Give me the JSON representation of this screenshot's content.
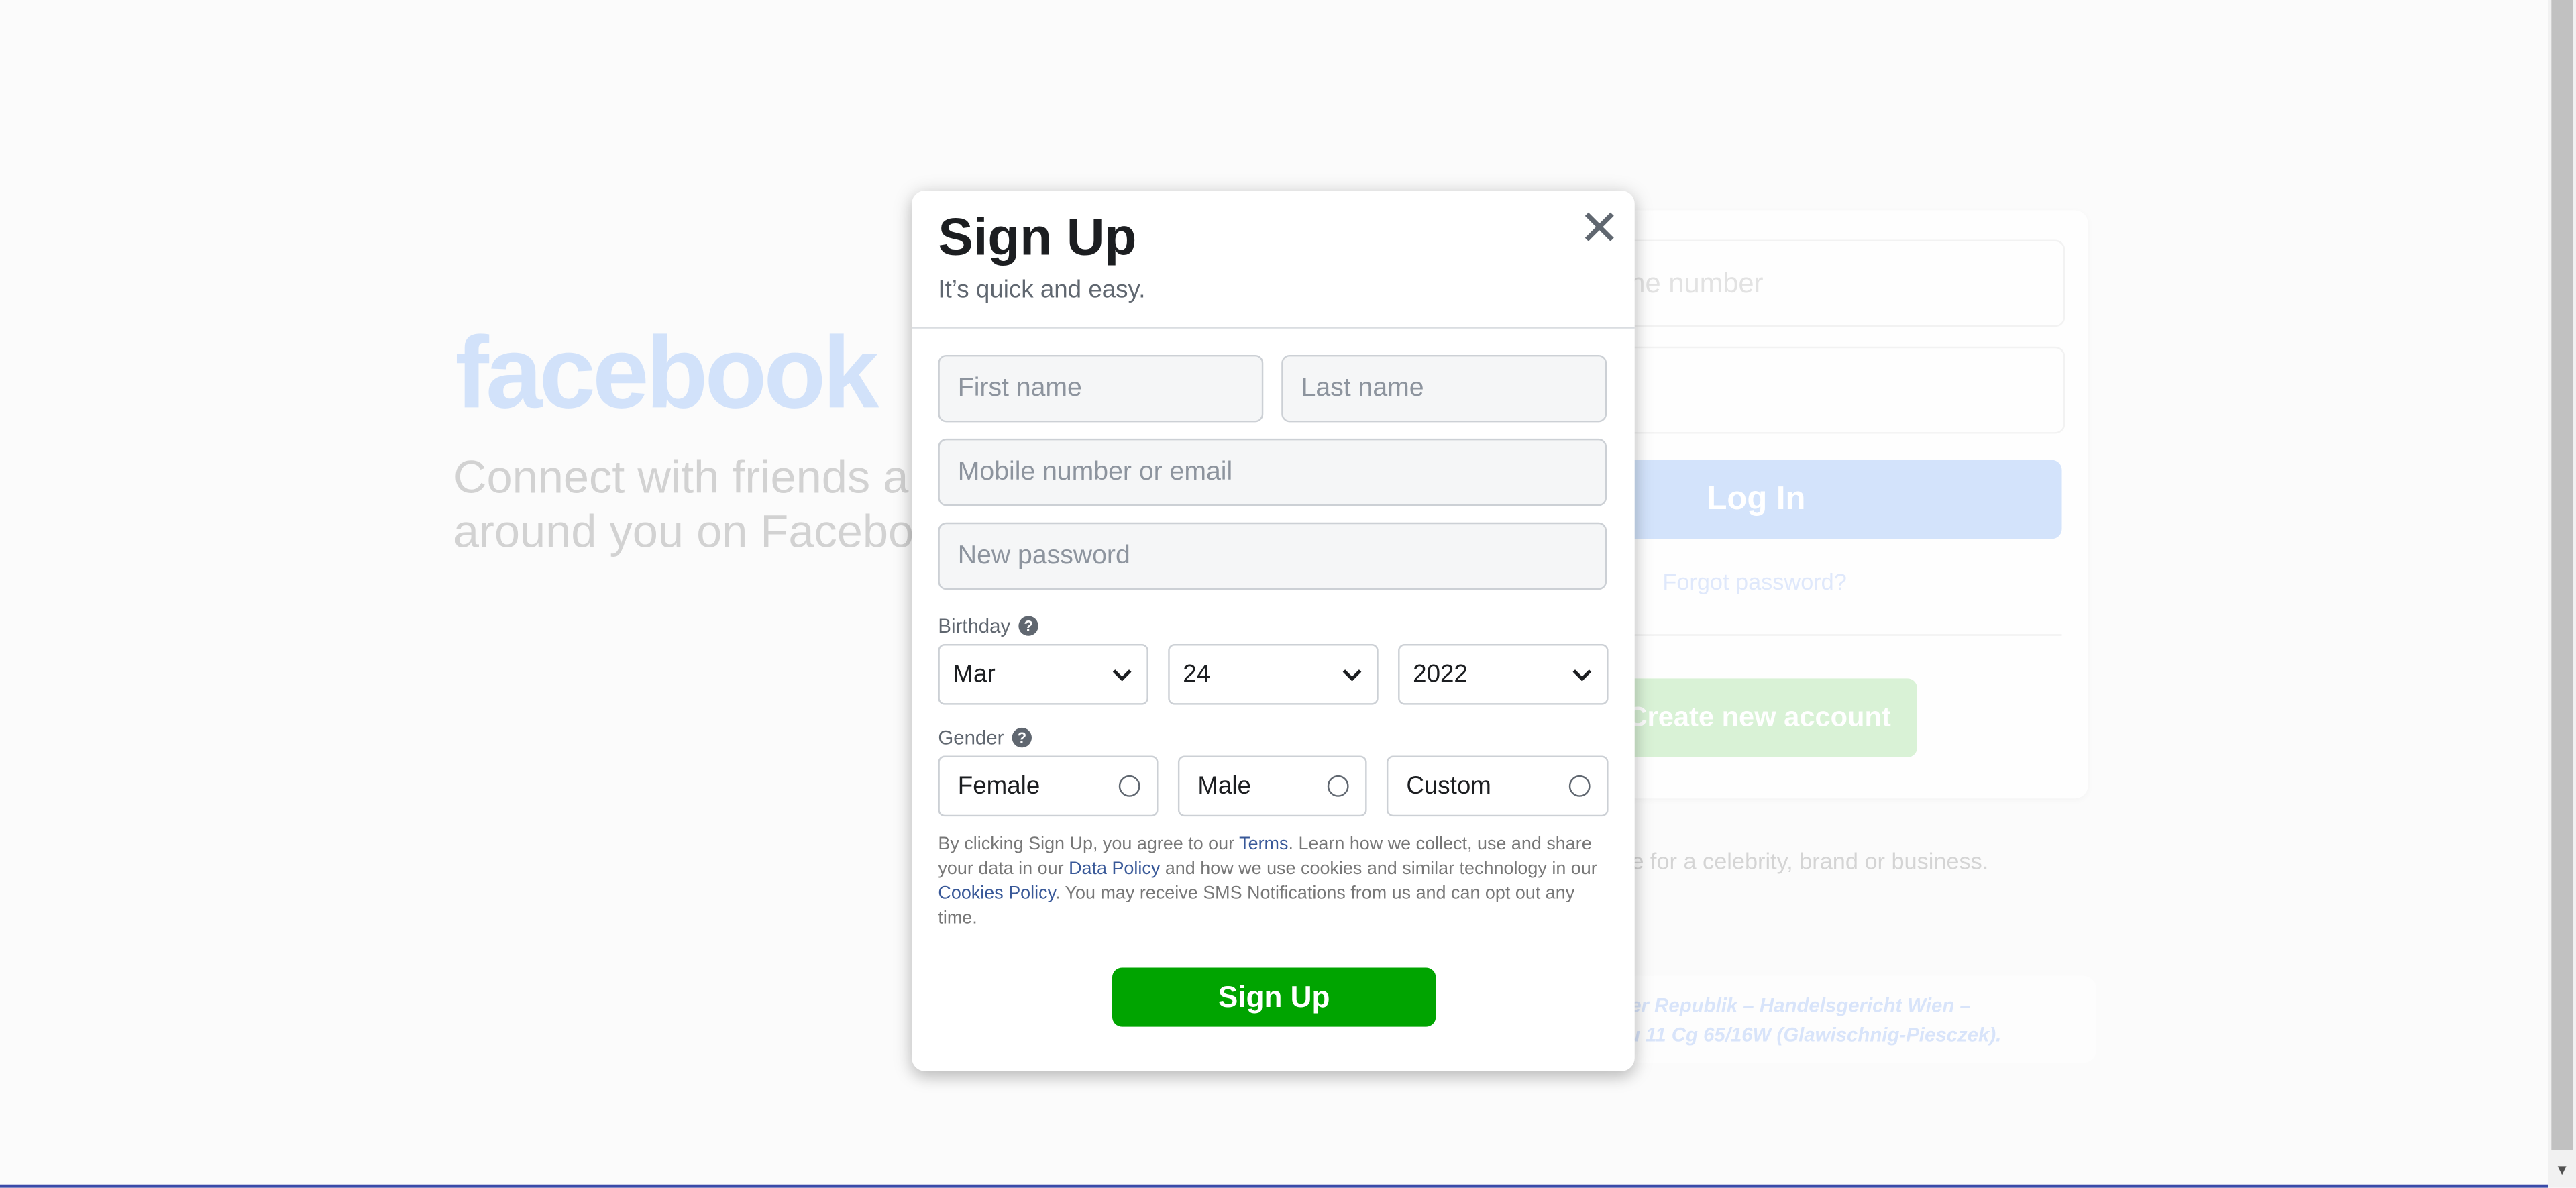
{
  "background": {
    "logo": "facebook",
    "tagline_lines": [
      "Connect with friends a",
      "around you on Facebo"
    ],
    "login": {
      "email_placeholder_fragment": "ne number",
      "login_label": "Log In",
      "forgot_label": "Forgot password?",
      "create_label": "Create new account"
    },
    "page_line_fragment": "ge for a celebrity, brand or business.",
    "footer_lines": [
      "der Republik – Handelsgericht Wien –",
      "zu 11 Cg 65/16W (Glawischnig-Piesczek)."
    ]
  },
  "modal": {
    "title": "Sign Up",
    "subtitle": "It’s quick and easy.",
    "close_icon": "close-icon",
    "first_name_placeholder": "First name",
    "last_name_placeholder": "Last name",
    "contact_placeholder": "Mobile number or email",
    "password_placeholder": "New password",
    "birthday_label": "Birthday",
    "birthday": {
      "month": "Mar",
      "day": "24",
      "year": "2022"
    },
    "gender_label": "Gender",
    "genders": [
      "Female",
      "Male",
      "Custom"
    ],
    "legal": {
      "t1": "By clicking Sign Up, you agree to our ",
      "terms": "Terms",
      "t2": ". Learn how we collect, use and share your data in our ",
      "data_policy": "Data Policy",
      "t3": " and how we use cookies and similar technology in our ",
      "cookies_policy": "Cookies Policy",
      "t4": ". You may receive SMS Notifications from us and can opt out any time."
    },
    "signup_label": "Sign Up"
  },
  "colors": {
    "signup_green": "#00a400",
    "link_blue": "#385898",
    "brand_blue": "#1877f2"
  }
}
